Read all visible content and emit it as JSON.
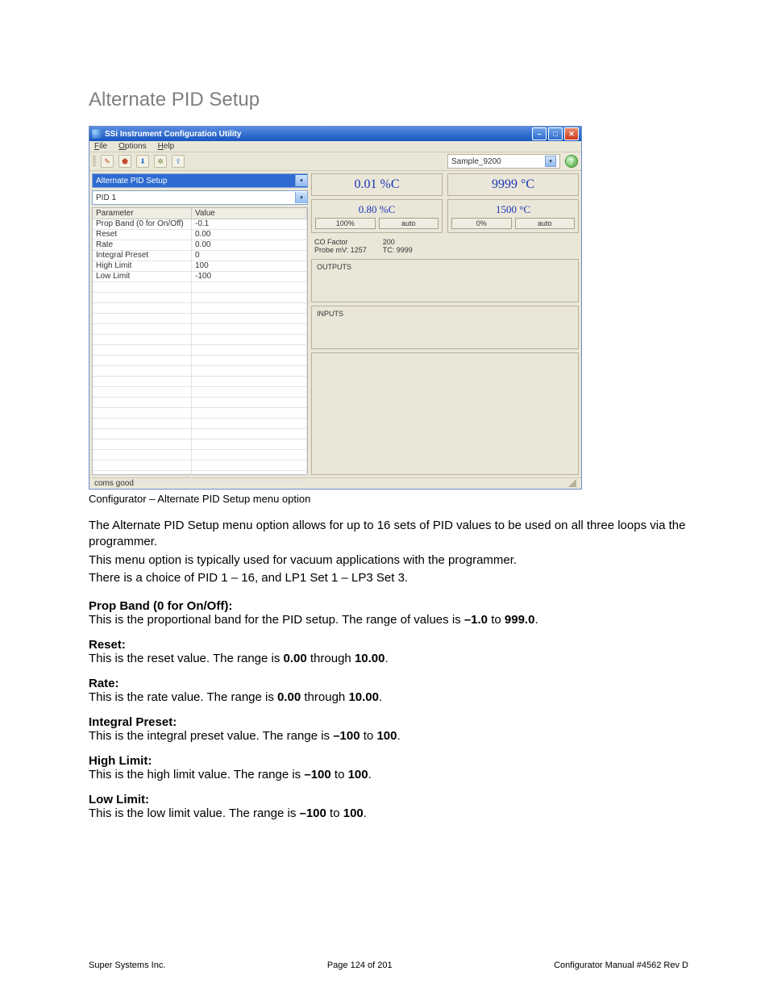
{
  "page": {
    "heading": "Alternate PID Setup",
    "caption": "Configurator – Alternate PID Setup menu option",
    "intro1": "The Alternate PID Setup menu option allows for up to 16 sets of PID values to be used on all three loops via the programmer.",
    "intro2": "This menu option is typically used for vacuum applications with the programmer.",
    "intro3": "There is a choice of PID 1 – 16, and LP1 Set 1 – LP3 Set 3."
  },
  "defs": [
    {
      "title": "Prop Band (0 for On/Off):",
      "pre": "This is the proportional band for the PID setup.  The range of values is ",
      "b1": "–1.0",
      "mid": " to ",
      "b2": "999.0",
      "post": "."
    },
    {
      "title": "Reset:",
      "pre": "This is the reset value.  The range is ",
      "b1": "0.00",
      "mid": " through ",
      "b2": "10.00",
      "post": "."
    },
    {
      "title": "Rate:",
      "pre": "This is the rate value.  The range is ",
      "b1": "0.00",
      "mid": " through ",
      "b2": "10.00",
      "post": "."
    },
    {
      "title": "Integral Preset:",
      "pre": "This is the integral preset value.  The range is ",
      "b1": "–100",
      "mid": " to ",
      "b2": "100",
      "post": "."
    },
    {
      "title": "High Limit:",
      "pre": "This is the high limit value.  The range is ",
      "b1": "–100",
      "mid": " to ",
      "b2": "100",
      "post": "."
    },
    {
      "title": "Low Limit:",
      "pre": "This is the low limit value.  The range is ",
      "b1": "–100",
      "mid": " to ",
      "b2": "100",
      "post": "."
    }
  ],
  "footer": {
    "left": "Super Systems Inc.",
    "center": "Page 124 of 201",
    "right": "Configurator Manual #4562 Rev D"
  },
  "app": {
    "title": "SSi Instrument Configuration Utility",
    "menus": {
      "file": "File",
      "options": "Options",
      "help": "Help"
    },
    "sample": "Sample_9200",
    "combo_section": "Alternate PID Setup",
    "combo_pid": "PID 1",
    "table": {
      "h1": "Parameter",
      "h2": "Value",
      "rows": [
        {
          "p": "Prop Band (0 for On/Off)",
          "v": "-0.1"
        },
        {
          "p": "Reset",
          "v": "0.00"
        },
        {
          "p": "Rate",
          "v": "0.00"
        },
        {
          "p": "Integral Preset",
          "v": "0"
        },
        {
          "p": "High Limit",
          "v": "100"
        },
        {
          "p": "Low Limit",
          "v": "-100"
        }
      ]
    },
    "readouts": {
      "pv1": "0.01 %C",
      "sp1": "0.80 %C",
      "pv2": "9999 °C",
      "sp2": "1500 °C",
      "b1a": "100%",
      "b1b": "auto",
      "b2a": "0%",
      "b2b": "auto",
      "co_label": "CO Factor",
      "co_val": "200",
      "probe_label": "Probe mV: 1257",
      "tc_label": "TC: 9999",
      "outputs": "OUTPUTS",
      "inputs": "INPUTS"
    },
    "status": "coms good"
  }
}
